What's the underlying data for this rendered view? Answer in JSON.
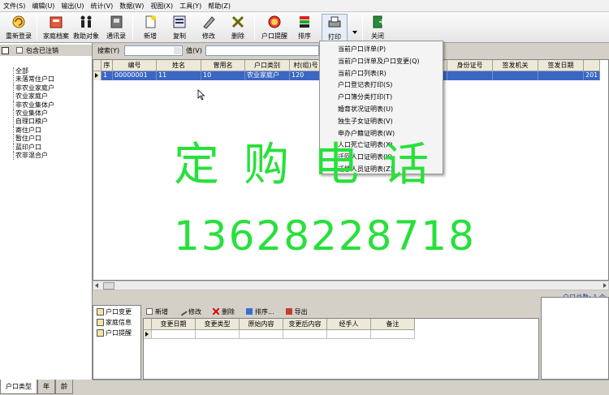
{
  "menubar": [
    "文件(S)",
    "编辑(U)",
    "输出(U)",
    "统计(V)",
    "数据(W)",
    "视图(X)",
    "工具(Y)",
    "帮助(Z)"
  ],
  "toolbar": {
    "buttons": [
      {
        "label": "重新登录",
        "icon": "refresh-login-icon"
      },
      {
        "label": "家庭档案",
        "icon": "family-record-icon"
      },
      {
        "label": "救助对象",
        "icon": "aid-target-icon"
      },
      {
        "label": "通讯录",
        "icon": "address-book-icon"
      },
      {
        "label": "新增",
        "icon": "new-icon"
      },
      {
        "label": "复制",
        "icon": "copy-icon"
      },
      {
        "label": "修改",
        "icon": "edit-icon"
      },
      {
        "label": "删除",
        "icon": "delete-icon"
      },
      {
        "label": "户口提醒",
        "icon": "alarm-icon"
      },
      {
        "label": "排序",
        "icon": "sort-icon"
      },
      {
        "label": "打印",
        "icon": "printer-icon"
      },
      {
        "label": "关闭",
        "icon": "exit-icon"
      }
    ]
  },
  "left": {
    "include_cancelled": "包含已注销",
    "tree": [
      "全部",
      "未落常住户口",
      "非农业家庭户",
      "农业家庭户",
      "非农业集体户",
      "农业集体户",
      "自理口粮户",
      "寄住户口",
      "暂住户口",
      "蓝印户口",
      "农非混合户"
    ]
  },
  "search": {
    "label": "搜索(Y)",
    "value_label": "值(V)"
  },
  "grid": {
    "columns": [
      "序",
      "编号",
      "姓名",
      "曾用名",
      "户口类别",
      "村(组)号",
      "",
      "",
      "",
      "关系",
      "身份证号",
      "签发机关",
      "签发日期",
      ""
    ],
    "rows": [
      [
        "1",
        "00000001",
        "11",
        "10",
        "农业家庭户",
        "120",
        "",
        "",
        "",
        "",
        "",
        "",
        "",
        "201"
      ]
    ]
  },
  "status": {
    "total": "户口总数: 1 个"
  },
  "subnav": [
    "户口变更",
    "家庭信息",
    "户口提醒"
  ],
  "subtoolbar": [
    "新增",
    "修改",
    "删除",
    "排序...",
    "导出"
  ],
  "subgrid": {
    "columns": [
      "变更日期",
      "变更类型",
      "原始内容",
      "变更后内容",
      "经手人",
      "备注"
    ]
  },
  "tabs": [
    "户口类型",
    "年",
    "龄"
  ],
  "dropdown": [
    "当前户口详单(P)",
    "当前户口详单及户口变更(Q)",
    "当前户口列表(R)",
    "户口登记表打印(S)",
    "户口簿分类打印(T)",
    "婚育状况证明表(U)",
    "独生子女证明表(V)",
    "申办户籍证明表(W)",
    "人口死亡证明表(X)",
    "迁回人口证明表(Y)",
    "迁移人员证明表(Z)"
  ],
  "watermark": {
    "line1": "定购电话",
    "line2": "13628228718"
  },
  "colors": {
    "selection": "#3b66c4",
    "watermark": "#28e03c",
    "total_text": "#1a3fa8"
  }
}
